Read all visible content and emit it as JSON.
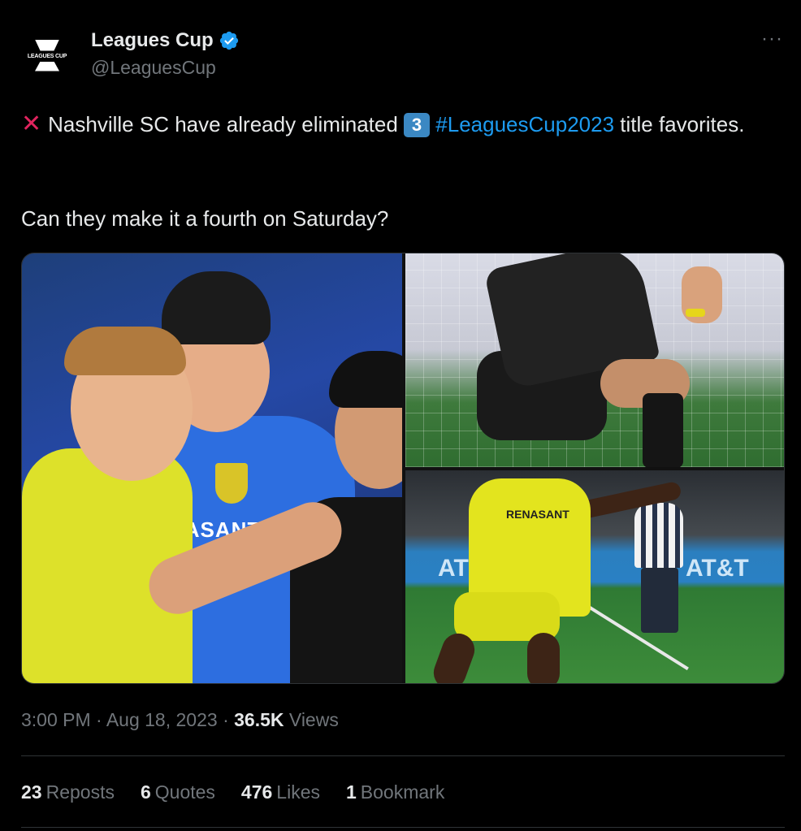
{
  "author": {
    "display_name": "Leagues Cup",
    "handle": "@LeaguesCup",
    "verified": true,
    "avatar_text": "LEAGUES CUP"
  },
  "more_label": "···",
  "tweet": {
    "part1": "Nashville SC have already eliminated",
    "keycap": "3",
    "hashtag": "#LeaguesCup2023",
    "part2": " title favorites.",
    "line2": "Can they make it a fourth on Saturday?"
  },
  "media": {
    "image_a_sponsor": "NASANT",
    "image_c_sponsor": "RENASANT",
    "image_c_board_left": "AT",
    "image_c_board_right": "AT&T"
  },
  "meta": {
    "time": "3:00 PM",
    "date": "Aug 18, 2023",
    "views_count": "36.5K",
    "views_label": "Views"
  },
  "stats": [
    {
      "num": "23",
      "label": "Reposts"
    },
    {
      "num": "6",
      "label": "Quotes"
    },
    {
      "num": "476",
      "label": "Likes"
    },
    {
      "num": "1",
      "label": "Bookmark"
    }
  ],
  "colors": {
    "background": "#000000",
    "text": "#e7e9ea",
    "muted": "#71767b",
    "link": "#1d9bf0",
    "verified": "#1d9bf0",
    "x_mark": "#e0245e"
  }
}
